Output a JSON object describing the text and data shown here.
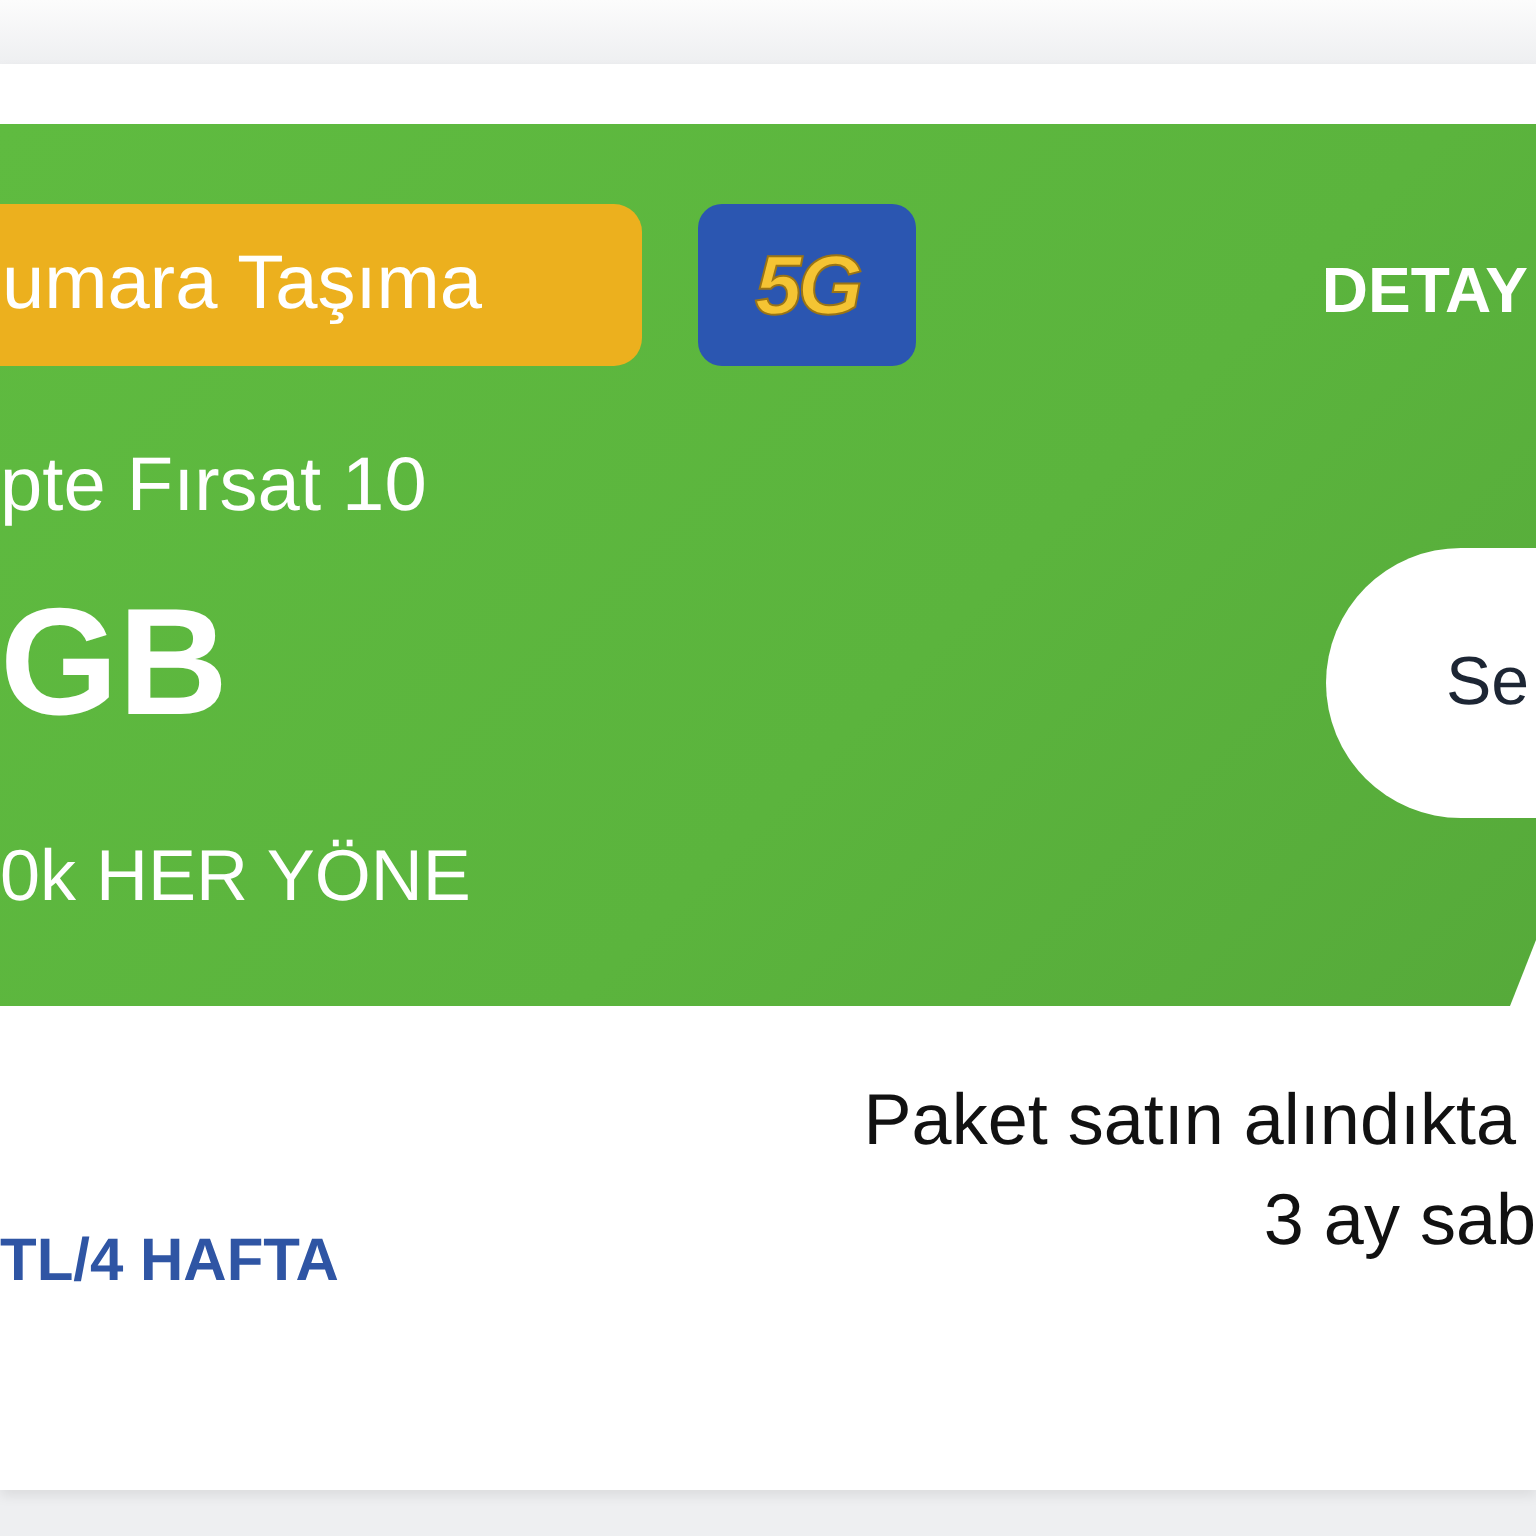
{
  "banner": {
    "tag": "umara Taşıma",
    "network_badge": "5G",
    "details_link": "DETAY",
    "plan_name": "pte Fırsat 10",
    "data_amount": "GB",
    "minutes": "0k HER YÖNE",
    "select_button": "Se"
  },
  "price": "TL/4 HAFTA",
  "note_lines": [
    "Paket satın alındıkta",
    "3 ay sab"
  ]
}
